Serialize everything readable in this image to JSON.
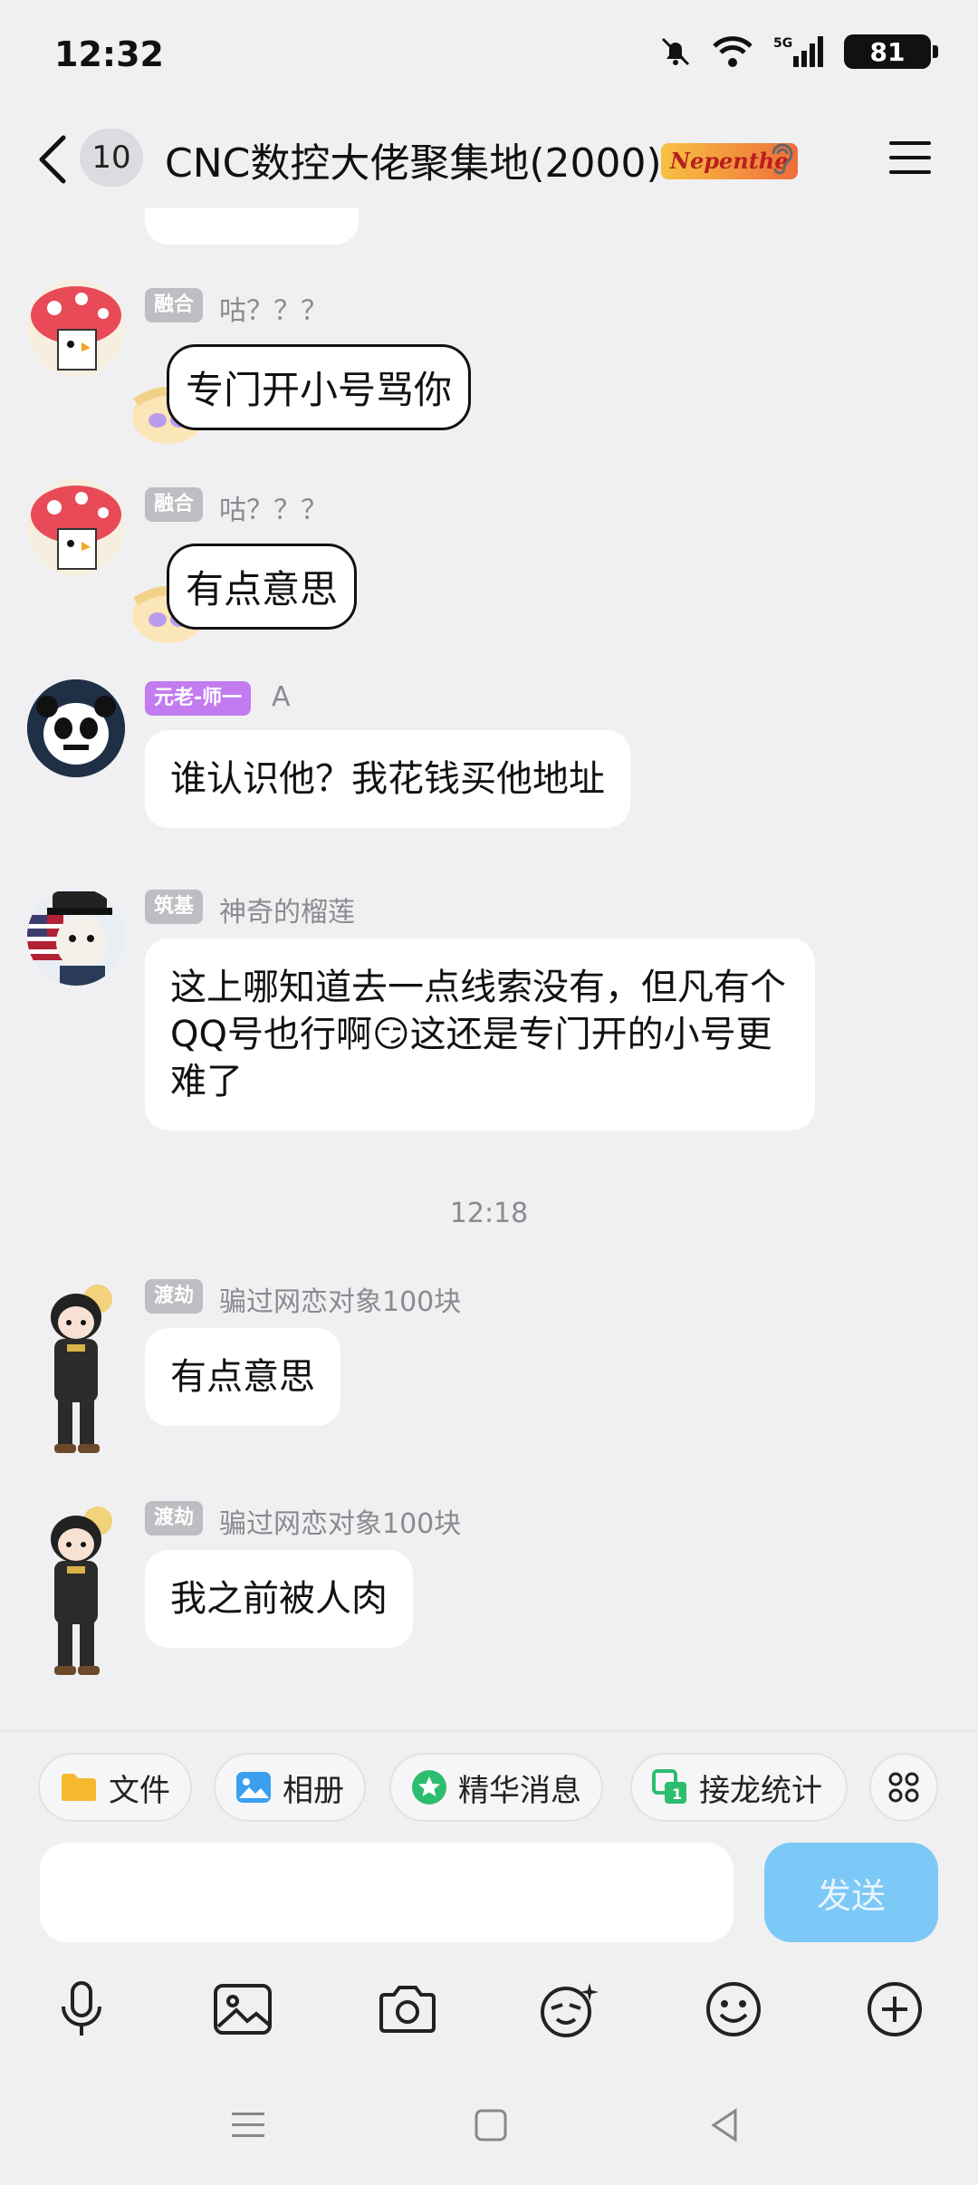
{
  "status_bar": {
    "time": "12:32",
    "network": "5G",
    "battery": "81"
  },
  "header": {
    "unread_count": "10",
    "title": "CNC数控大佬聚集地(2000)",
    "tag": "Nepenthe"
  },
  "messages": [
    {
      "role": "融合",
      "nick": "咕？？？",
      "sticker_text": "专门开小号骂你"
    },
    {
      "role": "融合",
      "nick": "咕？？？",
      "sticker_text": "有点意思"
    },
    {
      "role": "元老-师一",
      "nick": "A",
      "text": "谁认识他？我花钱买他地址"
    },
    {
      "role": "筑基",
      "nick": "神奇的榴莲",
      "text": "这上哪知道去一点线索没有，但凡有个QQ号也行啊😏这还是专门开的小号更难了"
    },
    {
      "role": "渡劫",
      "nick": "骗过网恋对象100块",
      "text": "有点意思"
    },
    {
      "role": "渡劫",
      "nick": "骗过网恋对象100块",
      "text": "我之前被人肉"
    }
  ],
  "time_divider": "12:18",
  "shortcuts": [
    "文件",
    "相册",
    "精华消息",
    "接龙统计"
  ],
  "input": {
    "placeholder": "",
    "send_label": "发送"
  },
  "colors": {
    "send_button": "#7cc8f6",
    "role_gray": "#bdbdc2",
    "role_purple": "#c27cf0",
    "background": "#f0f0f2"
  },
  "icons": [
    "mic-icon",
    "image-icon",
    "camera-icon",
    "emoji-plus-icon",
    "smile-icon",
    "plus-icon"
  ]
}
